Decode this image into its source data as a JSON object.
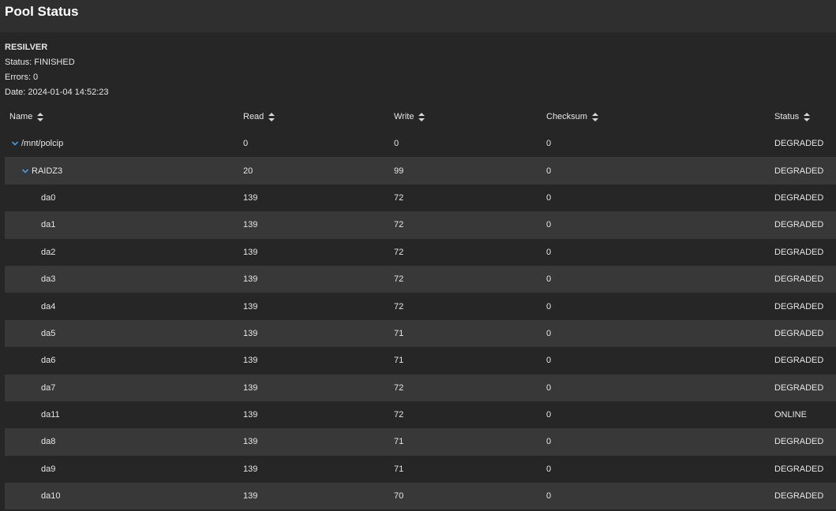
{
  "header": {
    "title": "Pool Status"
  },
  "scan": {
    "title": "RESILVER",
    "status": "Status: FINISHED",
    "errors": "Errors: 0",
    "date": "Date: 2024-01-04 14:52:23"
  },
  "columns": {
    "name": "Name",
    "read": "Read",
    "write": "Write",
    "checksum": "Checksum",
    "status": "Status"
  },
  "rows": [
    {
      "name": "/mnt/polcip",
      "read": "0",
      "write": "0",
      "checksum": "0",
      "status": "DEGRADED",
      "level": 0,
      "expandable": true
    },
    {
      "name": "RAIDZ3",
      "read": "20",
      "write": "99",
      "checksum": "0",
      "status": "DEGRADED",
      "level": 1,
      "expandable": true
    },
    {
      "name": "da0",
      "read": "139",
      "write": "72",
      "checksum": "0",
      "status": "DEGRADED",
      "level": 2
    },
    {
      "name": "da1",
      "read": "139",
      "write": "72",
      "checksum": "0",
      "status": "DEGRADED",
      "level": 2
    },
    {
      "name": "da2",
      "read": "139",
      "write": "72",
      "checksum": "0",
      "status": "DEGRADED",
      "level": 2
    },
    {
      "name": "da3",
      "read": "139",
      "write": "72",
      "checksum": "0",
      "status": "DEGRADED",
      "level": 2
    },
    {
      "name": "da4",
      "read": "139",
      "write": "72",
      "checksum": "0",
      "status": "DEGRADED",
      "level": 2
    },
    {
      "name": "da5",
      "read": "139",
      "write": "71",
      "checksum": "0",
      "status": "DEGRADED",
      "level": 2
    },
    {
      "name": "da6",
      "read": "139",
      "write": "71",
      "checksum": "0",
      "status": "DEGRADED",
      "level": 2
    },
    {
      "name": "da7",
      "read": "139",
      "write": "72",
      "checksum": "0",
      "status": "DEGRADED",
      "level": 2
    },
    {
      "name": "da11",
      "read": "139",
      "write": "72",
      "checksum": "0",
      "status": "ONLINE",
      "level": 2
    },
    {
      "name": "da8",
      "read": "139",
      "write": "71",
      "checksum": "0",
      "status": "DEGRADED",
      "level": 2
    },
    {
      "name": "da9",
      "read": "139",
      "write": "71",
      "checksum": "0",
      "status": "DEGRADED",
      "level": 2
    },
    {
      "name": "da10",
      "read": "139",
      "write": "70",
      "checksum": "0",
      "status": "DEGRADED",
      "level": 2
    }
  ],
  "colors": {
    "accent": "#3d9be9",
    "row_alt": "#383838",
    "background": "#262626"
  }
}
